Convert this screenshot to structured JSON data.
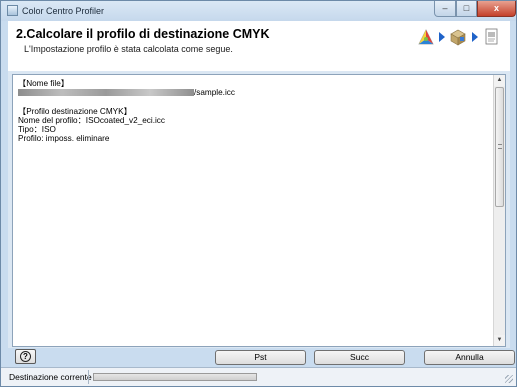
{
  "window": {
    "title": "Color Centro Profiler",
    "min_label": "–",
    "max_label": "□",
    "close_label": "x"
  },
  "header": {
    "title": "2.Calcolare il profilo di destinazione CMYK",
    "subtitle": "L'Impostazione profilo è stata calcolata come segue.",
    "workflow_icons": [
      "color-palette-icon",
      "printer-box-icon",
      "document-icon"
    ]
  },
  "content": {
    "file_section_label": "【Nome file】",
    "file_path_suffix": "/sample.icc",
    "profile_section_label": "【Profilo destinazione CMYK】",
    "profile_name_line": "Nome del profilo：ISOcoated_v2_eci.icc",
    "type_line": "Tipo：ISO",
    "profile_status_line": "Profilo: imposs. eliminare"
  },
  "buttons": {
    "help_label": "?",
    "prev_label": "Pst",
    "next_label": "Succ",
    "cancel_label": "Annulla"
  },
  "status": {
    "label": "Destinazione corrente"
  },
  "colors": {
    "accent_arrow": "#1f63c9",
    "frame": "#c9dcef"
  }
}
